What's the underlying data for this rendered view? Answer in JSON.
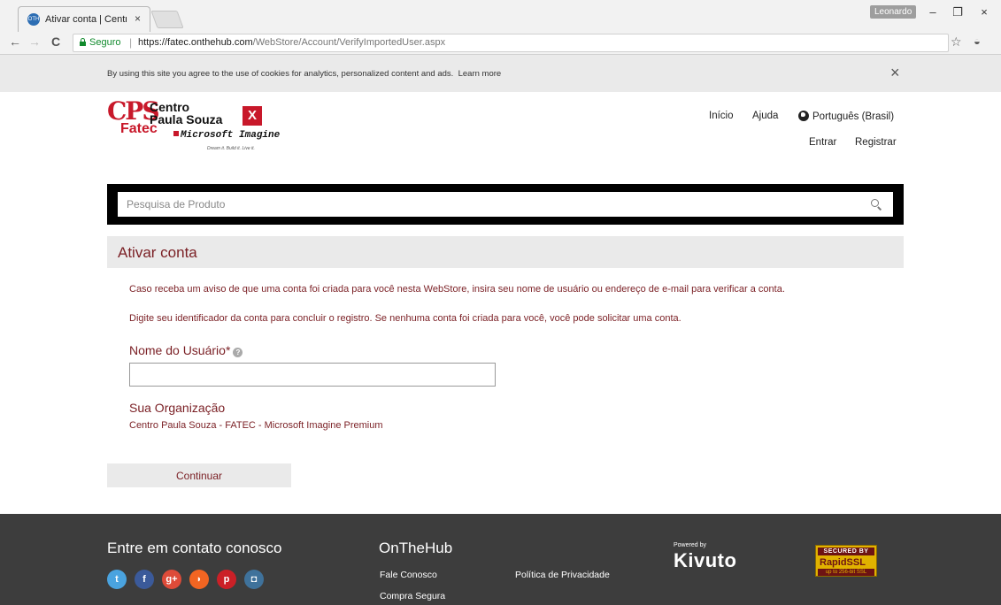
{
  "browser": {
    "tab_title": "Ativar conta | Centro Pau",
    "tab_favicon_text": "OTH",
    "tab_close": "×",
    "user_badge": "Leonardo",
    "win_minimize": "–",
    "win_restore": "❐",
    "win_close": "×",
    "nav_back": "←",
    "nav_forward": "→",
    "nav_reload": "C",
    "secure_label": "Seguro",
    "url_host": "https://fatec.onthehub.com",
    "url_path": "/WebStore/Account/VerifyImportedUser.aspx",
    "bookmark_star": "☆",
    "extension_glyph": "◒"
  },
  "cookie_banner": {
    "text": "By using this site you agree to the use of cookies for analytics, personalized content and ads.",
    "learn_more": "Learn more",
    "close": "×"
  },
  "logo": {
    "cps": "CPS",
    "centro": "Centro",
    "paula_souza": "Paula Souza",
    "x": "X",
    "fatec": "Fatec",
    "microsoft_imagine": "Microsoft Imagine",
    "tagline": "Dream it. Build it. Live it."
  },
  "header_nav": {
    "inicio": "Início",
    "ajuda": "Ajuda",
    "language": "Português (Brasil)",
    "entrar": "Entrar",
    "registrar": "Registrar"
  },
  "search": {
    "placeholder": "Pesquisa de Produto"
  },
  "main": {
    "title": "Ativar conta",
    "para1": "Caso receba um aviso de que uma conta foi criada para você nesta WebStore, insira seu nome de usuário ou endereço de e-mail para verificar a conta.",
    "para2_a": "Digite seu identificador da conta para concluir o registro. Se nenhuma conta foi criada para você, você pode ",
    "para2_link": "solicitar uma conta",
    "para2_b": ".",
    "username_label": "Nome do Usuário*",
    "username_value": "",
    "org_label": "Sua Organização",
    "org_value": "Centro Paula Souza - FATEC - Microsoft Imagine Premium",
    "continue": "Continuar"
  },
  "footer": {
    "contact_heading": "Entre em contato conosco",
    "onthehub_heading": "OnTheHub",
    "fale_conosco": "Fale Conosco",
    "compra_segura": "Compra Segura",
    "politica": "Política de Privacidade",
    "powered_by": "Powered by",
    "kivuto": "Kivuto",
    "ssl_top": "SECURED BY",
    "ssl_mid": "RapidSSL",
    "ssl_bot": "up to 256-bit SSL",
    "social": [
      {
        "name": "twitter",
        "glyph": "t",
        "color": "#4aa3df"
      },
      {
        "name": "facebook",
        "glyph": "f",
        "color": "#3b5a9a"
      },
      {
        "name": "google-plus",
        "glyph": "g+",
        "color": "#dd4b39"
      },
      {
        "name": "rss",
        "glyph": "◗",
        "color": "#f26522"
      },
      {
        "name": "pinterest",
        "glyph": "p",
        "color": "#cb2027"
      },
      {
        "name": "instagram",
        "glyph": "◘",
        "color": "#3f729b"
      }
    ]
  }
}
